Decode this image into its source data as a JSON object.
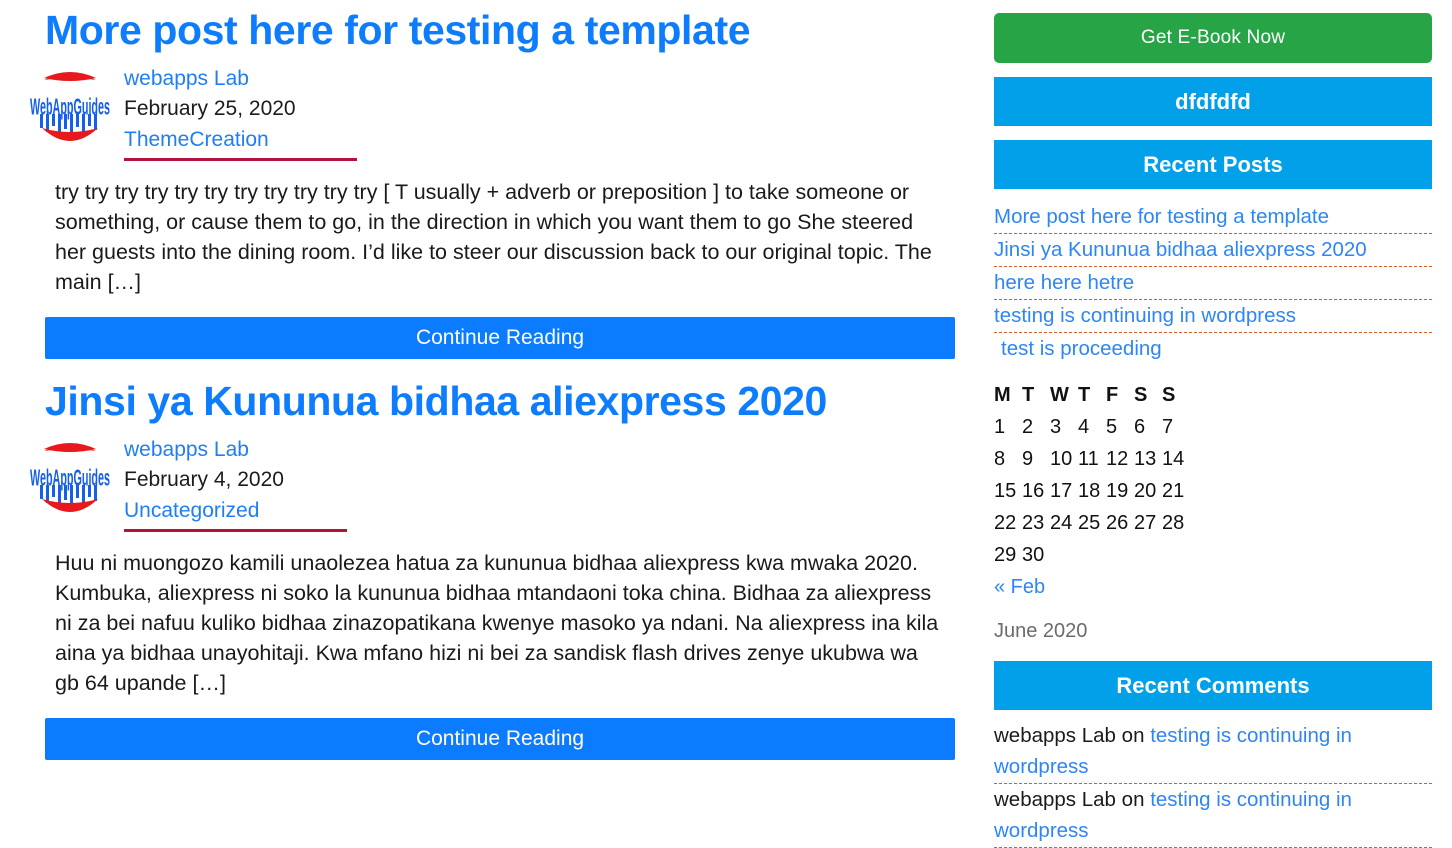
{
  "main": {
    "posts": [
      {
        "title": "More post here for testing a template",
        "author": "webapps Lab",
        "date": "February 25, 2020",
        "category": "ThemeCreation",
        "excerpt": "try try try try try try try try try try try [ T usually + adverb or preposition ] to take someone or something, or cause them to go, in the direction in which you want them to go She steered her guests into the dining room. I’d like to steer our discussion back to our original topic. The main […]",
        "read_more": "Continue Reading",
        "avatar_alt": "WebAppGuides"
      },
      {
        "title": "Jinsi ya Kununua bidhaa aliexpress 2020",
        "author": "webapps Lab",
        "date": "February 4, 2020",
        "category": "Uncategorized",
        "excerpt": "Huu ni muongozo kamili unaolezea hatua za kununua bidhaa aliexpress kwa mwaka 2020. Kumbuka, aliexpress ni soko la kununua bidhaa mtandaoni toka china. Bidhaa za aliexpress ni za bei nafuu kuliko bidhaa zinazopatikana kwenye masoko ya ndani. Na aliexpress ina kila aina ya bidhaa unayohitaji. Kwa mfano hizi ni bei za sandisk flash drives zenye ukubwa wa gb 64 upande […]",
        "read_more": "Continue Reading",
        "avatar_alt": "WebAppGuides"
      }
    ]
  },
  "sidebar": {
    "ebook_button": "Get E-Book Now",
    "widget_dfdfdfd": {
      "title": "dfdfdfd"
    },
    "recent_posts": {
      "title": "Recent Posts",
      "items": [
        "More post here for testing a template",
        "Jinsi ya Kununua bidhaa aliexpress 2020",
        "here here hetre",
        "testing is continuing in wordpress",
        "test is proceeding"
      ]
    },
    "calendar": {
      "weekdays": [
        "M",
        "T",
        "W",
        "T",
        "F",
        "S",
        "S"
      ],
      "weeks": [
        [
          "1",
          "2",
          "3",
          "4",
          "5",
          "6",
          "7"
        ],
        [
          "8",
          "9",
          "10",
          "11",
          "12",
          "13",
          "14"
        ],
        [
          "15",
          "16",
          "17",
          "18",
          "19",
          "20",
          "21"
        ],
        [
          "22",
          "23",
          "24",
          "25",
          "26",
          "27",
          "28"
        ],
        [
          "29",
          "30",
          "",
          "",
          "",
          "",
          ""
        ]
      ],
      "prev_link": "« Feb",
      "caption": "June 2020"
    },
    "recent_comments": {
      "title": "Recent Comments",
      "items": [
        {
          "author": "webapps Lab",
          "on": "on",
          "post": "testing is continuing in wordpress"
        },
        {
          "author": "webapps Lab",
          "on": "on",
          "post": "testing is continuing in wordpress"
        }
      ]
    }
  },
  "colors": {
    "heading_blue": "#0d7cfd",
    "button_blue": "#0b7bff",
    "widget_blue": "#02a0e8",
    "green": "#27a546",
    "link_blue": "#2e86f5",
    "category_underline": "#b3123c",
    "dashed_separator": "#e05a23",
    "logo_red": "#e8191c",
    "logo_blue": "#1560e8"
  }
}
